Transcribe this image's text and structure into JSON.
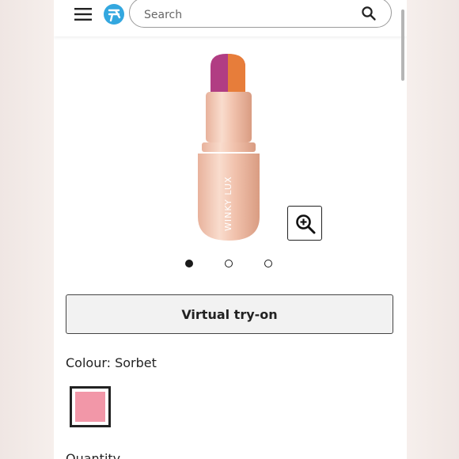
{
  "header": {
    "menu_icon": "hamburger-menu-icon",
    "logo_icon": "brand-logo-icon",
    "search": {
      "placeholder": "Search",
      "value": ""
    },
    "search_icon": "search-icon"
  },
  "product": {
    "image_icon": "lipstick-product-image",
    "brand_print": "WINKY LUX",
    "zoom_icon": "zoom-in-icon",
    "carousel": {
      "count": 3,
      "active_index": 0
    }
  },
  "actions": {
    "virtual_tryon_label": "Virtual try-on"
  },
  "colour": {
    "label": "Colour: Sorbet",
    "swatch_color": "#f297a8"
  },
  "quantity": {
    "label": "Quantity"
  }
}
